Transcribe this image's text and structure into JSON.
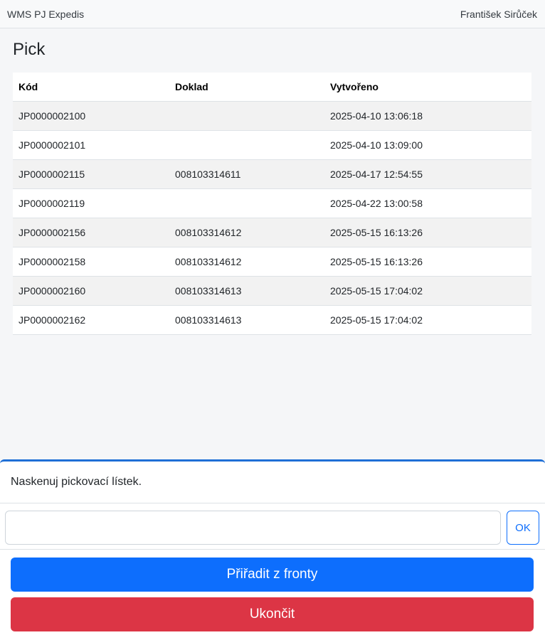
{
  "header": {
    "app_name": "WMS PJ Expedis",
    "user_name": "František Sirůček"
  },
  "page": {
    "title": "Pick"
  },
  "table": {
    "columns": [
      "Kód",
      "Doklad",
      "Vytvořeno"
    ],
    "rows": [
      [
        "JP0000002100",
        "",
        "2025-04-10 13:06:18"
      ],
      [
        "JP0000002101",
        "",
        "2025-04-10 13:09:00"
      ],
      [
        "JP0000002115",
        "008103314611",
        "2025-04-17 12:54:55"
      ],
      [
        "JP0000002119",
        "",
        "2025-04-22 13:00:58"
      ],
      [
        "JP0000002156",
        "008103314612",
        "2025-05-15 16:13:26"
      ],
      [
        "JP0000002158",
        "008103314612",
        "2025-05-15 16:13:26"
      ],
      [
        "JP0000002160",
        "008103314613",
        "2025-05-15 17:04:02"
      ],
      [
        "JP0000002162",
        "008103314613",
        "2025-05-15 17:04:02"
      ]
    ]
  },
  "scan": {
    "prompt": "Naskenuj pickovací lístek.",
    "value": "",
    "ok_label": "OK"
  },
  "actions": {
    "assign_label": "Přiřadit z fronty",
    "finish_label": "Ukončit"
  },
  "colors": {
    "primary": "#0d6efd",
    "danger": "#dc3545",
    "panel_accent": "#1f6fd6"
  }
}
